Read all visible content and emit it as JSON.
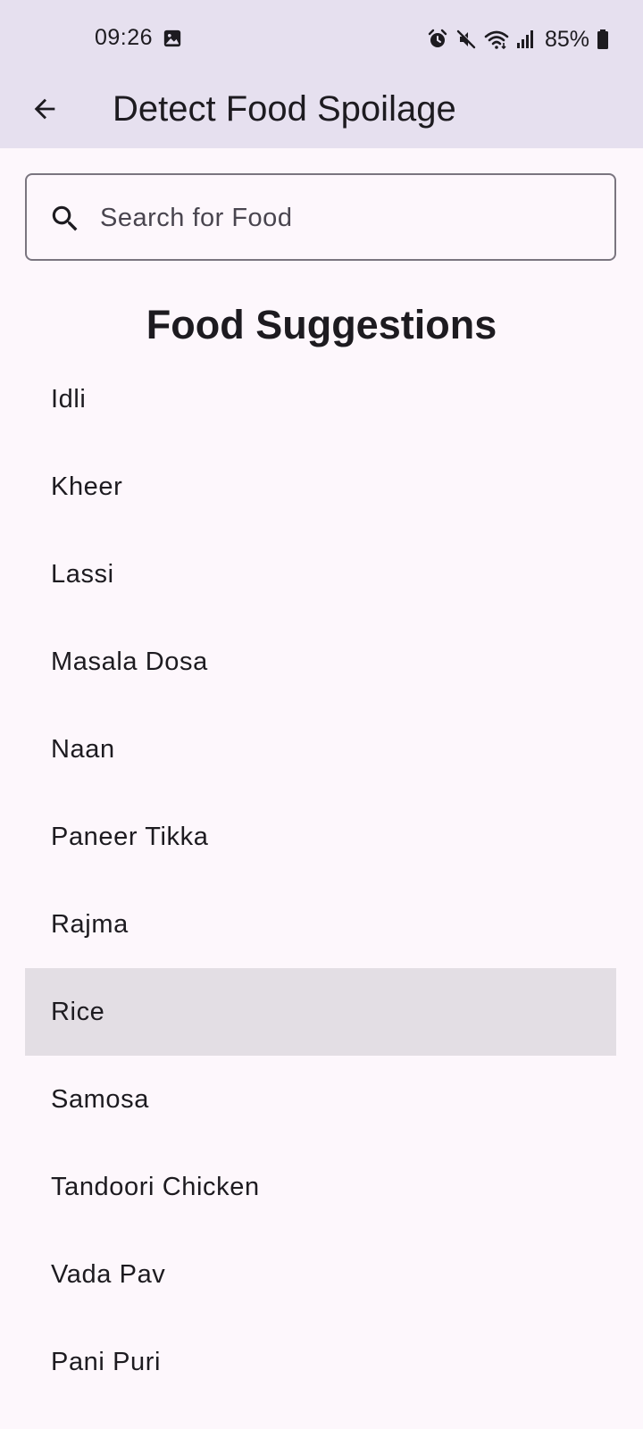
{
  "status_bar": {
    "time": "09:26",
    "battery": "85%",
    "icons": [
      "gallery-icon",
      "alarm-icon",
      "mute-icon",
      "wifi-icon",
      "signal-icon",
      "battery-icon"
    ]
  },
  "app_bar": {
    "back_icon": "arrow-back-icon",
    "title": "Detect Food Spoilage"
  },
  "search": {
    "icon": "search-icon",
    "placeholder": "Search for Food",
    "value": ""
  },
  "suggestions": {
    "title": "Food Suggestions",
    "items": [
      {
        "label": "Idli"
      },
      {
        "label": "Kheer"
      },
      {
        "label": "Lassi"
      },
      {
        "label": "Masala Dosa"
      },
      {
        "label": "Naan"
      },
      {
        "label": "Paneer Tikka"
      },
      {
        "label": "Rajma"
      },
      {
        "label": "Rice"
      },
      {
        "label": "Samosa"
      },
      {
        "label": "Tandoori Chicken"
      },
      {
        "label": "Vada Pav"
      },
      {
        "label": "Pani Puri"
      }
    ],
    "highlighted_item": "Rice"
  },
  "colors": {
    "header_bg": "#E6E0EF",
    "page_bg": "#FDF7FC",
    "highlight_bg": "#E3DEE4",
    "text": "#1D1B20"
  }
}
